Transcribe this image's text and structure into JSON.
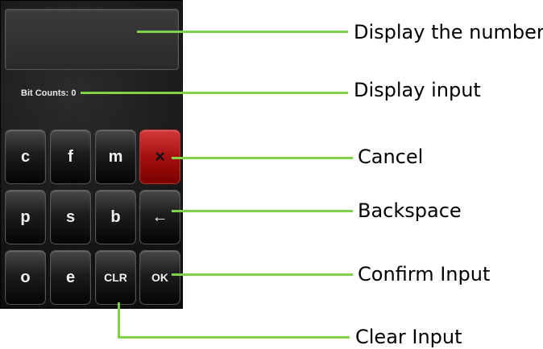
{
  "screen": {
    "bit_counts": "Bit Counts: 0",
    "keys": {
      "row1": [
        "c",
        "f",
        "m",
        "×"
      ],
      "row2": [
        "p",
        "s",
        "b",
        "←"
      ],
      "row3": [
        "o",
        "e",
        "CLR",
        "OK"
      ]
    }
  },
  "annotations": {
    "display_number": "Display the number",
    "display_input": "Display input",
    "cancel": "Cancel",
    "backspace": "Backspace",
    "confirm_input": "Confirm Input",
    "clear_input": "Clear Input"
  },
  "colors": {
    "callout_line": "#7fd348",
    "cancel_key": "#b01414"
  }
}
